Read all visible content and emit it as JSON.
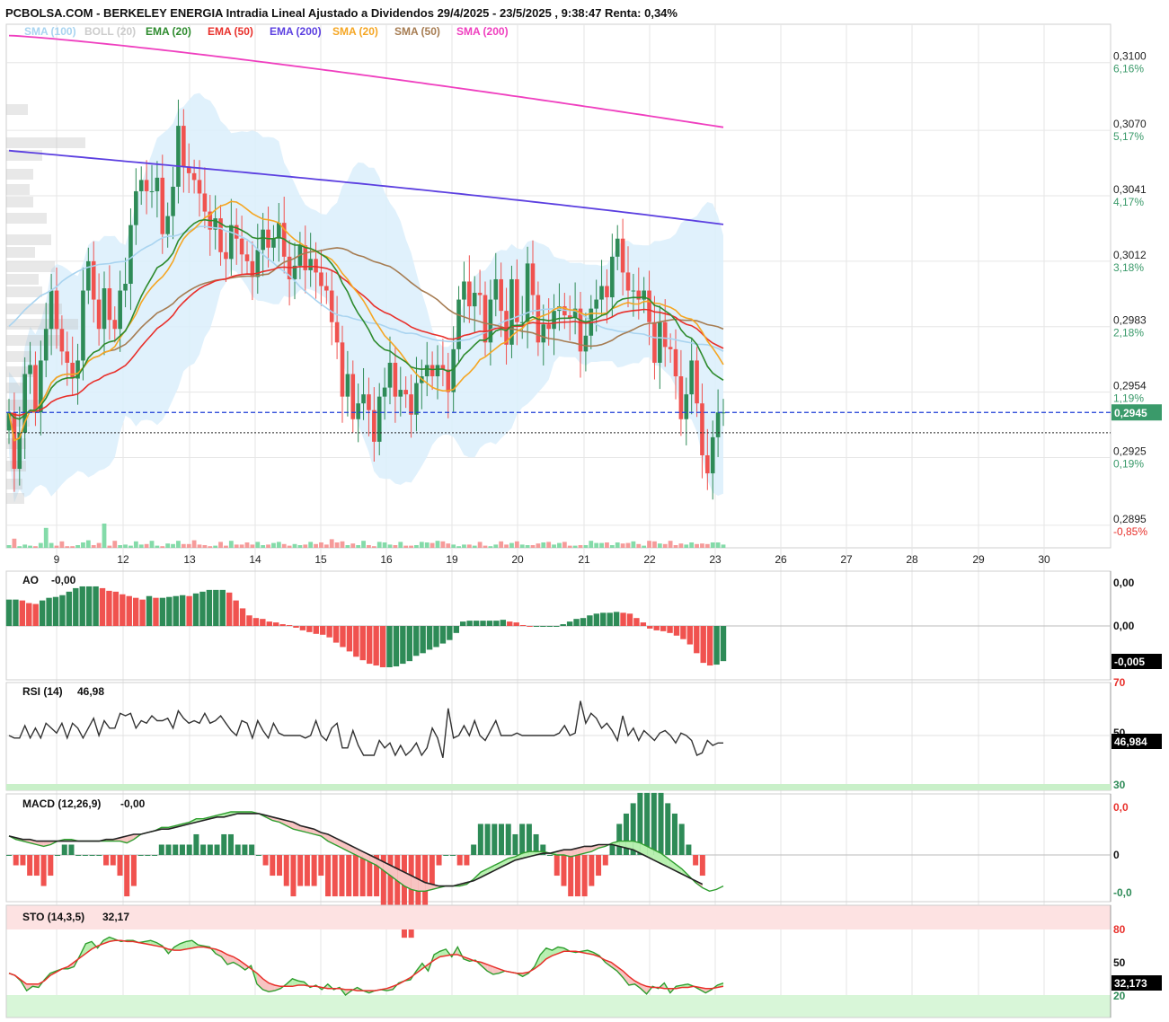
{
  "header": {
    "title": "PCBOLSA.COM - BERKELEY ENERGIA Intradia Lineal Ajustado a Dividendos 29/4/2025 - 23/5/2025 , 9:38:47 Renta: 0,34%"
  },
  "colors": {
    "up": "#2e8b57",
    "down": "#f0524f",
    "sma100": "#a9d4f0",
    "boll_fill": "#dbeefb",
    "ema20": "#2e8b2e",
    "ema50": "#e8302b",
    "ema200": "#5b3fe0",
    "sma20": "#f5a623",
    "sma50": "#a67c52",
    "sma200": "#ef3fbf",
    "price_tag": "#3a9a6a",
    "ref_line": "#1f3fd6",
    "grid": "#e6e6e6"
  },
  "legend": [
    {
      "label": "SMA (100)",
      "color": "#a9d4f0"
    },
    {
      "label": "BOLL (20)",
      "color": "#cccccc"
    },
    {
      "label": "EMA (20)",
      "color": "#2e8b2e"
    },
    {
      "label": "EMA (50)",
      "color": "#e8302b"
    },
    {
      "label": "EMA (200)",
      "color": "#5b3fe0"
    },
    {
      "label": "SMA (20)",
      "color": "#f5a623"
    },
    {
      "label": "SMA (50)",
      "color": "#a67c52"
    },
    {
      "label": "SMA (200)",
      "color": "#ef3fbf"
    }
  ],
  "chart_data": [
    {
      "type": "candlestick",
      "title": "PCBOLSA.COM - BERKELEY ENERGIA Intradia Lineal Ajustado a Dividendos 29/4/2025 - 23/5/2025 , 9:38:47 Renta: 0,34%",
      "x_ticks": [
        "9",
        "12",
        "13",
        "14",
        "15",
        "16",
        "19",
        "20",
        "21",
        "22",
        "23",
        "26",
        "27",
        "28",
        "29",
        "30"
      ],
      "y_ticks": [
        {
          "price": "0,3100",
          "pct": "6,16%"
        },
        {
          "price": "0,3070",
          "pct": "5,17%"
        },
        {
          "price": "0,3041",
          "pct": "4,17%"
        },
        {
          "price": "0,3012",
          "pct": "3,18%"
        },
        {
          "price": "0,2983",
          "pct": "2,18%"
        },
        {
          "price": "0,2954",
          "pct": "1,19%"
        },
        {
          "price": "0,2925",
          "pct": "0,19%"
        },
        {
          "price": "0,2895",
          "pct": "-0,85%"
        }
      ],
      "last_price": "0,2945",
      "ylim": [
        0.2885,
        0.3117
      ],
      "closes": [
        0.2945,
        0.292,
        0.2936,
        0.2962,
        0.2966,
        0.2945,
        0.2968,
        0.2982,
        0.2999,
        0.2982,
        0.2972,
        0.2967,
        0.296,
        0.2968,
        0.2999,
        0.3012,
        0.2995,
        0.2982,
        0.3,
        0.2986,
        0.2982,
        0.2999,
        0.3002,
        0.3028,
        0.3043,
        0.3048,
        0.3043,
        0.3043,
        0.3049,
        0.3024,
        0.3032,
        0.3045,
        0.3072,
        0.3054,
        0.3051,
        0.3048,
        0.3042,
        0.3034,
        0.3026,
        0.3031,
        0.3016,
        0.3013,
        0.3028,
        0.3022,
        0.3015,
        0.3012,
        0.3005,
        0.3017,
        0.3026,
        0.3018,
        0.3022,
        0.3029,
        0.3014,
        0.3004,
        0.301,
        0.3019,
        0.3008,
        0.3013,
        0.3007,
        0.3001,
        0.2999,
        0.2985,
        0.2976,
        0.2952,
        0.2962,
        0.2942,
        0.2949,
        0.2953,
        0.2946,
        0.2932,
        0.2952,
        0.2956,
        0.2967,
        0.2952,
        0.2955,
        0.2953,
        0.2944,
        0.2958,
        0.2961,
        0.2966,
        0.2961,
        0.2966,
        0.2964,
        0.2954,
        0.2973,
        0.2995,
        0.3003,
        0.2992,
        0.2998,
        0.2997,
        0.2976,
        0.2995,
        0.3004,
        0.299,
        0.2975,
        0.3004,
        0.2985,
        0.2985,
        0.3011,
        0.2997,
        0.2976,
        0.2984,
        0.2982,
        0.299,
        0.2992,
        0.2988,
        0.2987,
        0.2991,
        0.2972,
        0.2979,
        0.2991,
        0.2995,
        0.3001,
        0.2996,
        0.3014,
        0.3022,
        0.3007,
        0.2999,
        0.2999,
        0.2995,
        0.2999,
        0.2985,
        0.2967,
        0.2985,
        0.2974,
        0.2973,
        0.2961,
        0.2942,
        0.2953,
        0.2968,
        0.2949,
        0.2926,
        0.2918,
        0.2934,
        0.2945,
        0.2945
      ],
      "volumes": [
        0.05,
        0.17,
        0.03,
        0.06,
        0.04,
        0.03,
        0.09,
        0.37,
        0.09,
        0.04,
        0.12,
        0.03,
        0.03,
        0.05,
        0.1,
        0.14,
        0.05,
        0.09,
        0.45,
        0.04,
        0.13,
        0.05,
        0.06,
        0.04,
        0.12,
        0.06,
        0.07,
        0.13,
        0.04,
        0.03,
        0.08,
        0.07,
        0.13,
        0.07,
        0.07,
        0.14,
        0.06,
        0.05,
        0.03,
        0.04,
        0.11,
        0.04,
        0.13,
        0.06,
        0.06,
        0.1,
        0.06,
        0.11,
        0.05,
        0.06,
        0.09,
        0.11,
        0.07,
        0.04,
        0.07,
        0.05,
        0.06,
        0.11,
        0.07,
        0.1,
        0.06,
        0.16,
        0.1,
        0.12,
        0.05,
        0.08,
        0.05,
        0.13,
        0.05,
        0.03,
        0.11,
        0.1,
        0.06,
        0.05,
        0.11,
        0.04,
        0.04,
        0.05,
        0.11,
        0.1,
        0.09,
        0.13,
        0.12,
        0.08,
        0.06,
        0.03,
        0.06,
        0.06,
        0.04,
        0.11,
        0.04,
        0.03,
        0.06,
        0.12,
        0.06,
        0.09,
        0.12,
        0.06,
        0.05,
        0.05,
        0.08,
        0.1,
        0.11,
        0.06,
        0.09,
        0.11,
        0.04,
        0.04,
        0.05,
        0.05,
        0.13,
        0.09,
        0.09,
        0.1,
        0.05,
        0.1,
        0.08,
        0.09,
        0.12,
        0.07,
        0.04,
        0.13,
        0.12,
        0.08,
        0.07,
        0.13,
        0.05,
        0.08,
        0.06,
        0.1,
        0.07,
        0.08,
        0.07,
        0.1,
        0.1,
        0.06
      ],
      "series": [
        {
          "name": "SMA (100)"
        },
        {
          "name": "BOLL (20)"
        },
        {
          "name": "EMA (20)"
        },
        {
          "name": "EMA (50)"
        },
        {
          "name": "EMA (200)"
        },
        {
          "name": "SMA (20)"
        },
        {
          "name": "SMA (50)"
        },
        {
          "name": "SMA (200)"
        }
      ]
    },
    {
      "type": "bar",
      "title": "AO",
      "value_label": "-0,00",
      "y_ticks": [
        "0,00",
        "0,00"
      ],
      "last_value": "-0,005",
      "values": [
        0.003,
        0.003,
        0.0029,
        0.0026,
        0.0025,
        0.0029,
        0.0032,
        0.0033,
        0.0035,
        0.0039,
        0.0043,
        0.0045,
        0.0045,
        0.0045,
        0.0043,
        0.004,
        0.0039,
        0.0036,
        0.0034,
        0.0032,
        0.003,
        0.0034,
        0.0032,
        0.0032,
        0.0033,
        0.0034,
        0.0035,
        0.0034,
        0.0037,
        0.0039,
        0.0041,
        0.0041,
        0.0041,
        0.0038,
        0.0029,
        0.002,
        0.0012,
        0.0009,
        0.0008,
        0.0005,
        0.0004,
        0.0002,
        0.0001,
        -0.0002,
        -0.0005,
        -0.0007,
        -0.0009,
        -0.001,
        -0.0013,
        -0.0019,
        -0.0024,
        -0.0029,
        -0.0035,
        -0.0039,
        -0.0043,
        -0.0045,
        -0.0047,
        -0.0047,
        -0.0046,
        -0.0043,
        -0.004,
        -0.0034,
        -0.0031,
        -0.0027,
        -0.0024,
        -0.002,
        -0.0016,
        -0.0008,
        0.0005,
        0.0006,
        0.0006,
        0.0006,
        0.0006,
        0.0006,
        0.0007,
        0.0005,
        0.0004,
        0.0001,
        -0.0001,
        -0.0001,
        -0.0001,
        -0.0001,
        -0.0001,
        0.0002,
        0.0005,
        0.0008,
        0.0009,
        0.0012,
        0.0014,
        0.0015,
        0.0015,
        0.0016,
        0.0015,
        0.0014,
        0.0009,
        0.0004,
        -0.0003,
        -0.0005,
        -0.0006,
        -0.0008,
        -0.0011,
        -0.0015,
        -0.0021,
        -0.0031,
        -0.0042,
        -0.0045,
        -0.0044,
        -0.004
      ]
    },
    {
      "type": "line",
      "title": "RSI (14)",
      "value_label": "46,98",
      "y_ticks": [
        "70",
        "50",
        "30"
      ],
      "ylim": [
        30,
        70
      ],
      "last_value": "46,984",
      "values": [
        50,
        49,
        49,
        54,
        49,
        53,
        49,
        55,
        53,
        51,
        55,
        49,
        55,
        53,
        49,
        53,
        57,
        50,
        56,
        53,
        53,
        59,
        58,
        59,
        53,
        56,
        55,
        58,
        56,
        56,
        57,
        53,
        60,
        57,
        55,
        56,
        55,
        59,
        55,
        56,
        58,
        55,
        52,
        50,
        56,
        55,
        49,
        56,
        52,
        49,
        55,
        51,
        50,
        50,
        50,
        50,
        49,
        50,
        56,
        50,
        48,
        53,
        55,
        45,
        45,
        52,
        46,
        42,
        42,
        42,
        48,
        45,
        47,
        42,
        46,
        42,
        44,
        47,
        42,
        45,
        53,
        49,
        41,
        61,
        49,
        50,
        54,
        50,
        56,
        50,
        48,
        52,
        56,
        50,
        50,
        50,
        51,
        50,
        50,
        50,
        50,
        50,
        50,
        50,
        51,
        54,
        50,
        51,
        64,
        55,
        59,
        57,
        53,
        55,
        52,
        48,
        58,
        50,
        53,
        48,
        52,
        50,
        48,
        51,
        52,
        50,
        47,
        51,
        50,
        48,
        42,
        43,
        48,
        46,
        47,
        47
      ]
    },
    {
      "type": "line",
      "title": "MACD (12,26,9)",
      "value_label": "-0,00",
      "y_ticks": [
        "0,0",
        "0",
        "-0,0"
      ],
      "series": [
        {
          "name": "MACD",
          "values": [
            0.0011,
            0.0009,
            0.0008,
            0.0007,
            0.0006,
            0.0005,
            0.0006,
            0.0008,
            0.0009,
            0.0009,
            0.0008,
            0.0008,
            0.0008,
            0.0008,
            0.0008,
            0.0008,
            0.0008,
            0.0007,
            0.0009,
            0.0012,
            0.0013,
            0.0014,
            0.0016,
            0.0016,
            0.0017,
            0.0018,
            0.0019,
            0.0021,
            0.0021,
            0.0022,
            0.0023,
            0.0024,
            0.0025,
            0.0025,
            0.0025,
            0.0025,
            0.0024,
            0.0022,
            0.002,
            0.0019,
            0.0017,
            0.0015,
            0.0014,
            0.0013,
            0.0012,
            0.0011,
            0.0008,
            0.0006,
            0.0004,
            0.0002,
            0.0,
            -0.0002,
            -0.0004,
            -0.0006,
            -0.0009,
            -0.0012,
            -0.0015,
            -0.0018,
            -0.002,
            -0.0021,
            -0.0021,
            -0.002,
            -0.0019,
            -0.0018,
            -0.0018,
            -0.0018,
            -0.0017,
            -0.0014,
            -0.001,
            -0.0008,
            -0.0006,
            -0.0004,
            -0.0002,
            -0.0001,
            0.0001,
            0.0002,
            0.0002,
            0.0002,
            0.0001,
            0.0,
            -0.0,
            -0.0001,
            0.0,
            0.0001,
            0.0002,
            0.0004,
            0.0005,
            0.0007,
            0.0008,
            0.0008,
            0.0008,
            0.0007,
            0.0005,
            0.0003,
            0.0001,
            -0.0002,
            -0.0005,
            -0.0008,
            -0.0012,
            -0.0016,
            -0.0019,
            -0.0021,
            -0.002,
            -0.0018
          ]
        },
        {
          "name": "Signal",
          "values": [
            0.0011,
            0.001,
            0.0009,
            0.0009,
            0.0008,
            0.0008,
            0.0008,
            0.0008,
            0.0008,
            0.0008,
            0.0008,
            0.0008,
            0.0008,
            0.0008,
            0.0009,
            0.0009,
            0.001,
            0.0011,
            0.0012,
            0.0012,
            0.0013,
            0.0014,
            0.0015,
            0.0015,
            0.0016,
            0.0017,
            0.0018,
            0.0019,
            0.002,
            0.0021,
            0.0022,
            0.0022,
            0.0023,
            0.0024,
            0.0024,
            0.0024,
            0.0024,
            0.0023,
            0.0022,
            0.0021,
            0.002,
            0.0019,
            0.0017,
            0.0016,
            0.0015,
            0.0013,
            0.0012,
            0.001,
            0.0008,
            0.0006,
            0.0004,
            0.0002,
            0.0,
            -0.0002,
            -0.0004,
            -0.0006,
            -0.0008,
            -0.001,
            -0.0012,
            -0.0014,
            -0.0016,
            -0.0017,
            -0.0018,
            -0.0018,
            -0.0018,
            -0.0017,
            -0.0016,
            -0.0015,
            -0.0013,
            -0.0011,
            -0.0009,
            -0.0007,
            -0.0005,
            -0.0003,
            -0.0002,
            -0.0001,
            0.0,
            0.0001,
            0.0001,
            0.0002,
            0.0003,
            0.0003,
            0.0004,
            0.0005,
            0.0005,
            0.0006,
            0.0006,
            0.0006,
            0.0005,
            0.0004,
            0.0003,
            0.0001,
            -0.0001,
            -0.0003,
            -0.0005,
            -0.0007,
            -0.0009,
            -0.0011,
            -0.0013,
            -0.0015,
            -0.0017
          ]
        }
      ]
    },
    {
      "type": "line",
      "title": "STO (14,3,5)",
      "value_label": "32,17",
      "y_ticks": [
        "80",
        "50",
        "20"
      ],
      "ylim": [
        20,
        80
      ],
      "last_value": "32,173",
      "series": [
        {
          "name": "%K",
          "values": [
            40,
            38,
            33,
            24,
            28,
            27,
            34,
            40,
            42,
            44,
            44,
            46,
            56,
            67,
            69,
            63,
            70,
            73,
            71,
            69,
            70,
            70,
            68,
            69,
            70,
            68,
            65,
            58,
            64,
            67,
            69,
            70,
            66,
            65,
            64,
            58,
            55,
            48,
            50,
            47,
            43,
            47,
            30,
            25,
            23,
            24,
            26,
            30,
            35,
            33,
            32,
            27,
            29,
            25,
            30,
            25,
            27,
            20,
            24,
            27,
            24,
            22,
            24,
            25,
            24,
            25,
            31,
            33,
            34,
            42,
            49,
            42,
            57,
            60,
            62,
            55,
            64,
            53,
            51,
            52,
            47,
            42,
            39,
            40,
            42,
            41,
            40,
            37,
            40,
            46,
            57,
            63,
            61,
            64,
            63,
            60,
            59,
            60,
            61,
            59,
            56,
            50,
            46,
            42,
            36,
            29,
            30,
            26,
            21,
            28,
            26,
            31,
            22,
            28,
            29,
            30,
            28,
            25,
            22,
            25,
            29,
            31
          ]
        },
        {
          "name": "%D",
          "values": [
            40,
            38,
            34,
            30,
            30,
            30,
            33,
            38,
            41,
            44,
            46,
            50,
            54,
            58,
            62,
            65,
            67,
            69,
            70,
            70,
            69,
            69,
            68,
            67,
            66,
            65,
            64,
            62,
            61,
            61,
            62,
            63,
            64,
            64,
            63,
            62,
            60,
            57,
            55,
            52,
            48,
            44,
            40,
            35,
            31,
            29,
            28,
            28,
            28,
            29,
            29,
            28,
            28,
            27,
            26,
            26,
            26,
            25,
            25,
            24,
            24,
            24,
            24,
            25,
            26,
            28,
            30,
            33,
            36,
            40,
            44,
            48,
            52,
            55,
            56,
            57,
            57,
            55,
            53,
            51,
            50,
            48,
            46,
            44,
            42,
            41,
            40,
            40,
            41,
            44,
            48,
            53,
            56,
            58,
            60,
            60,
            60,
            59,
            58,
            57,
            55,
            52,
            50,
            46,
            42,
            37,
            33,
            30,
            28,
            27,
            27,
            26,
            26,
            26,
            27,
            27,
            28,
            27,
            26,
            26,
            27,
            28
          ]
        }
      ]
    }
  ]
}
